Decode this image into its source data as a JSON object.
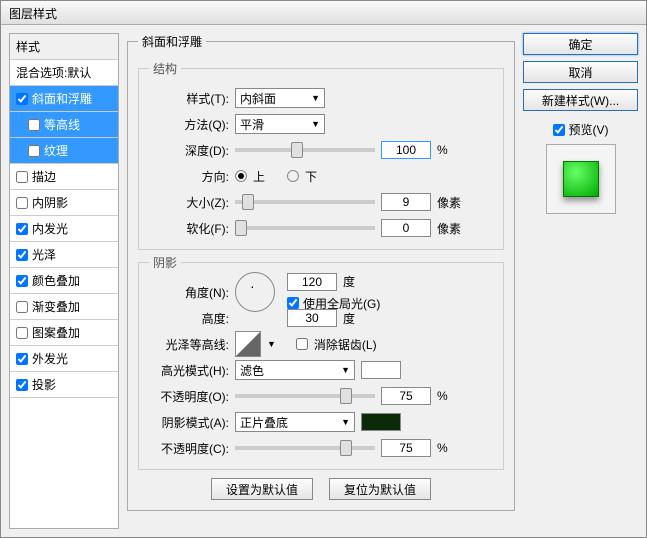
{
  "window": {
    "title": "图层样式"
  },
  "sidebar": {
    "header": "样式",
    "items": [
      {
        "label": "混合选项:默认",
        "checked": null
      },
      {
        "label": "斜面和浮雕",
        "checked": true,
        "selected": true
      },
      {
        "label": "等高线",
        "checked": false,
        "indent": true,
        "selected": true
      },
      {
        "label": "纹理",
        "checked": false,
        "indent": true,
        "selected": true
      },
      {
        "label": "描边",
        "checked": false
      },
      {
        "label": "内阴影",
        "checked": false
      },
      {
        "label": "内发光",
        "checked": true
      },
      {
        "label": "光泽",
        "checked": true
      },
      {
        "label": "颜色叠加",
        "checked": true
      },
      {
        "label": "渐变叠加",
        "checked": false
      },
      {
        "label": "图案叠加",
        "checked": false
      },
      {
        "label": "外发光",
        "checked": true
      },
      {
        "label": "投影",
        "checked": true
      }
    ]
  },
  "panel": {
    "title": "斜面和浮雕",
    "structure": {
      "title": "结构",
      "style_label": "样式(T):",
      "style_value": "内斜面",
      "method_label": "方法(Q):",
      "method_value": "平滑",
      "depth_label": "深度(D):",
      "depth_value": "100",
      "depth_unit": "%",
      "direction_label": "方向:",
      "up": "上",
      "down": "下",
      "size_label": "大小(Z):",
      "size_value": "9",
      "size_unit": "像素",
      "soften_label": "软化(F):",
      "soften_value": "0",
      "soften_unit": "像素"
    },
    "shading": {
      "title": "阴影",
      "angle_label": "角度(N):",
      "angle_value": "120",
      "angle_unit": "度",
      "global_label": "使用全局光(G)",
      "altitude_label": "高度:",
      "altitude_value": "30",
      "altitude_unit": "度",
      "gloss_label": "光泽等高线:",
      "antialias_label": "消除锯齿(L)",
      "highlight_mode_label": "高光模式(H):",
      "highlight_mode_value": "滤色",
      "highlight_opacity_label": "不透明度(O):",
      "highlight_opacity_value": "75",
      "opacity_unit": "%",
      "shadow_mode_label": "阴影模式(A):",
      "shadow_mode_value": "正片叠底",
      "shadow_opacity_label": "不透明度(C):",
      "shadow_opacity_value": "75"
    },
    "set_default": "设置为默认值",
    "reset_default": "复位为默认值"
  },
  "buttons": {
    "ok": "确定",
    "cancel": "取消",
    "new_style": "新建样式(W)...",
    "preview": "预览(V)"
  }
}
